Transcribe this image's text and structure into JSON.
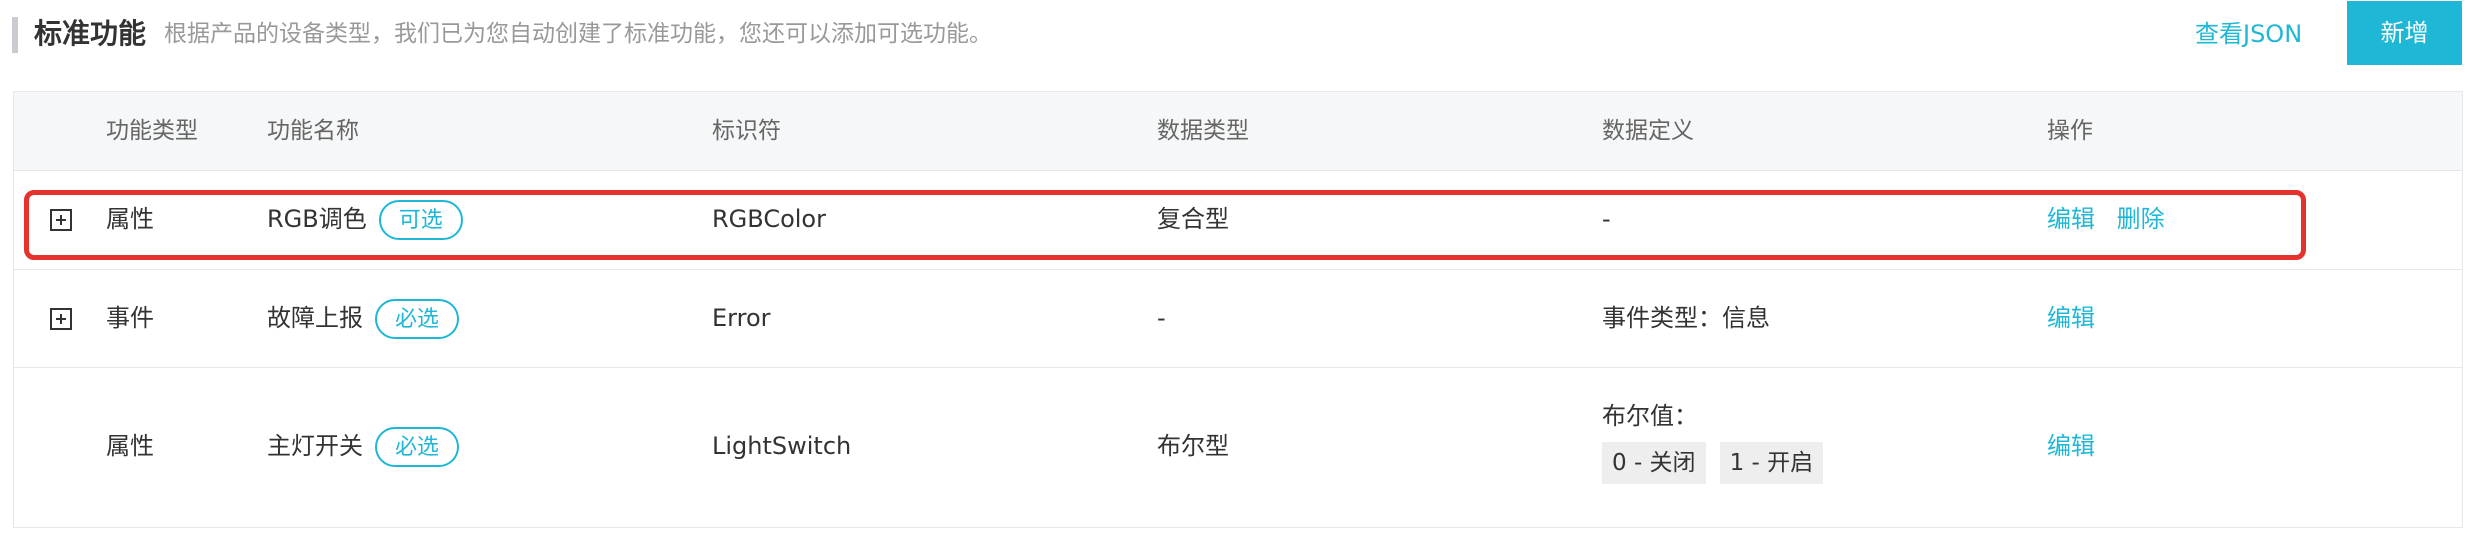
{
  "header": {
    "title": "标准功能",
    "subtitle": "根据产品的设备类型，我们已为您自动创建了标准功能，您还可以添加可选功能。",
    "json_link": "查看JSON",
    "add_button": "新增"
  },
  "table": {
    "columns": [
      "功能类型",
      "功能名称",
      "标识符",
      "数据类型",
      "数据定义",
      "操作"
    ],
    "rows": [
      {
        "type": "属性",
        "name": "RGB调色",
        "tag": "可选",
        "identifier": "RGBColor",
        "data_type": "复合型",
        "definition": "-",
        "edit": "编辑",
        "delete": "删除"
      },
      {
        "type": "事件",
        "name": "故障上报",
        "tag": "必选",
        "identifier": "Error",
        "data_type": "-",
        "definition": "事件类型：信息",
        "edit": "编辑"
      },
      {
        "type": "属性",
        "name": "主灯开关",
        "tag": "必选",
        "identifier": "LightSwitch",
        "data_type": "布尔型",
        "definition_label": "布尔值：",
        "definition_values": [
          "0 - 关闭",
          "1 - 开启"
        ],
        "edit": "编辑"
      }
    ]
  },
  "colors": {
    "accent": "#1fb7d6",
    "highlight_border": "#e6322d"
  }
}
